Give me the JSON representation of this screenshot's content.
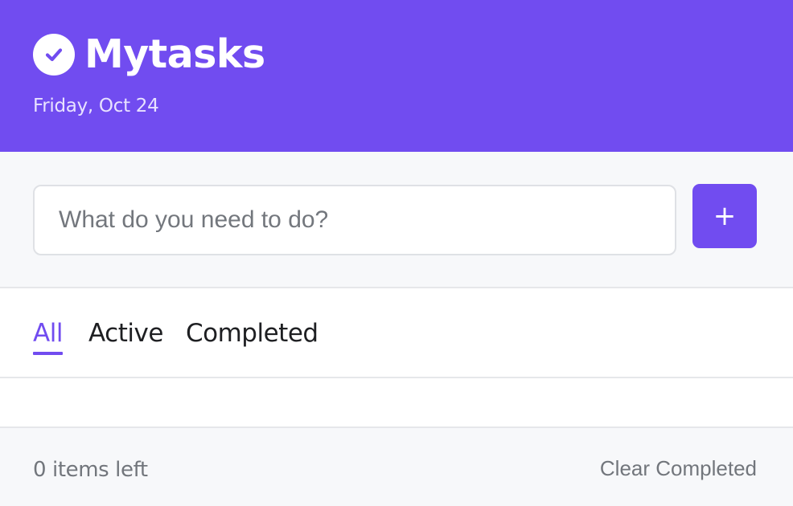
{
  "header": {
    "title": "Mytasks",
    "date": "Friday, Oct 24",
    "logo_icon": "check-circle-icon",
    "brand_color": "#714cf0"
  },
  "add_task": {
    "placeholder": "What do you need to do?",
    "value": "",
    "add_label": "+",
    "add_icon": "plus-icon"
  },
  "filters": {
    "tabs": [
      {
        "label": "All",
        "selected": true
      },
      {
        "label": "Active",
        "selected": false
      },
      {
        "label": "Completed",
        "selected": false
      }
    ]
  },
  "tasks": [],
  "footer": {
    "items_left": "0 items left",
    "clear_label": "Clear Completed"
  }
}
